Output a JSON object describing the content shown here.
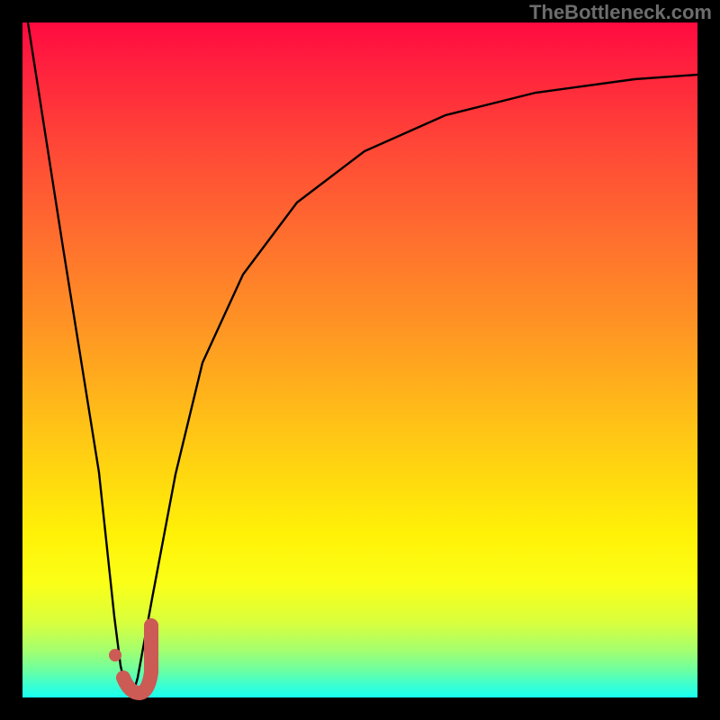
{
  "watermark": "TheBottleneck.com",
  "colors": {
    "background": "#000000",
    "curve": "#000000",
    "marker": "#cc5a55",
    "gradient_stops": [
      "#ff0a40",
      "#ff4637",
      "#ff9a22",
      "#fff207",
      "#3effce",
      "#18fff0"
    ]
  },
  "chart_data": {
    "type": "line",
    "title": "",
    "xlabel": "",
    "ylabel": "",
    "xlim": [
      0,
      100
    ],
    "ylim": [
      0,
      100
    ],
    "grid": false,
    "legend": false,
    "series": [
      {
        "name": "bottleneck-curve",
        "x": [
          0,
          5,
          10,
          13,
          14,
          15,
          16,
          17,
          19,
          22,
          26,
          32,
          40,
          50,
          62,
          76,
          90,
          100
        ],
        "y": [
          100,
          67,
          33,
          12,
          5,
          1,
          0,
          3,
          15,
          33,
          50,
          63,
          73,
          81,
          86,
          89,
          91,
          92
        ]
      }
    ],
    "markers": [
      {
        "name": "j-marker-dot",
        "x": 13.2,
        "y": 6.5
      },
      {
        "name": "j-marker-hook",
        "path_x": [
          14.5,
          15.6,
          17.0,
          18.2,
          18.8,
          18.8
        ],
        "path_y": [
          3.0,
          1.0,
          0.8,
          2.5,
          6.0,
          11.0
        ]
      }
    ]
  }
}
